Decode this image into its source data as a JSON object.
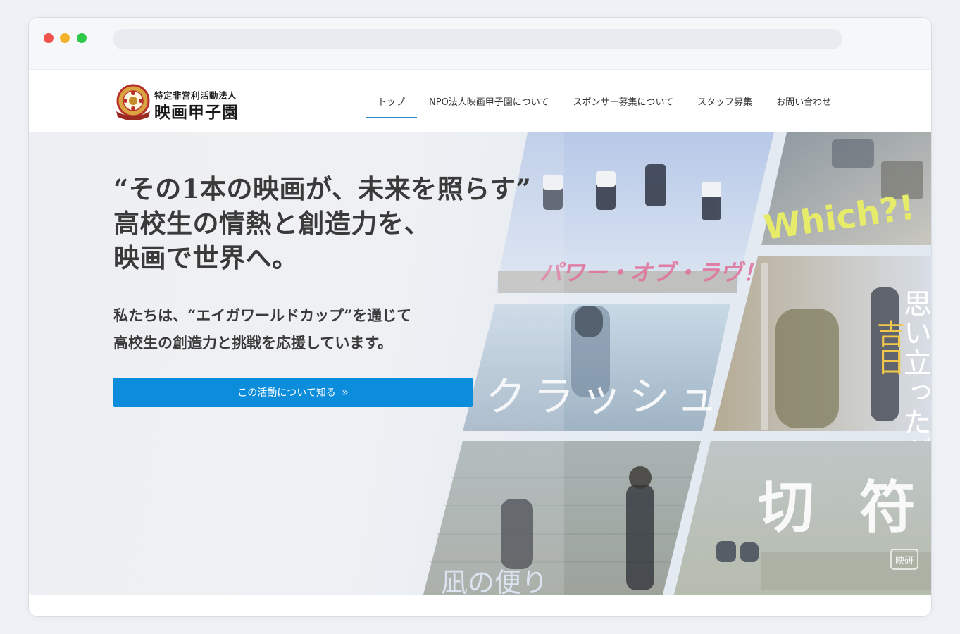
{
  "site": {
    "logo_small": "特定非営利活動法人",
    "logo_big": "映画甲子園",
    "logo_emblem_text": "eiga worldcup"
  },
  "nav": {
    "items": [
      {
        "label": "トップ",
        "active": true
      },
      {
        "label": "NPO法人映画甲子園について",
        "active": false
      },
      {
        "label": "スポンサー募集について",
        "active": false
      },
      {
        "label": "スタッフ募集",
        "active": false
      },
      {
        "label": "お問い合わせ",
        "active": false
      }
    ]
  },
  "hero": {
    "title_lines": [
      "“その1本の映画が、未来を照らす”",
      "高校生の情熱と創造力を、",
      "映画で世界へ。"
    ],
    "subtitle_lines": [
      "私たちは、“エイガワールドカップ”を通じて",
      "高校生の創造力と挑戦を応援しています。"
    ],
    "cta_label": "この活動について知る",
    "cta_icon": "double-chevron-right-icon"
  },
  "collage": {
    "posters": [
      {
        "title": "パワー・オブ・ラヴ！"
      },
      {
        "title": "Which?!"
      },
      {
        "title": "クラッシュ"
      },
      {
        "title": "思い立ったが"
      },
      {
        "title": "吉日"
      },
      {
        "title": "凪の便り"
      },
      {
        "title": "切 符"
      },
      {
        "title": "映研"
      }
    ]
  },
  "colors": {
    "accent": "#0c8ddc",
    "nav_underline": "#2a8ac7",
    "title_text": "#3a3a3a"
  }
}
